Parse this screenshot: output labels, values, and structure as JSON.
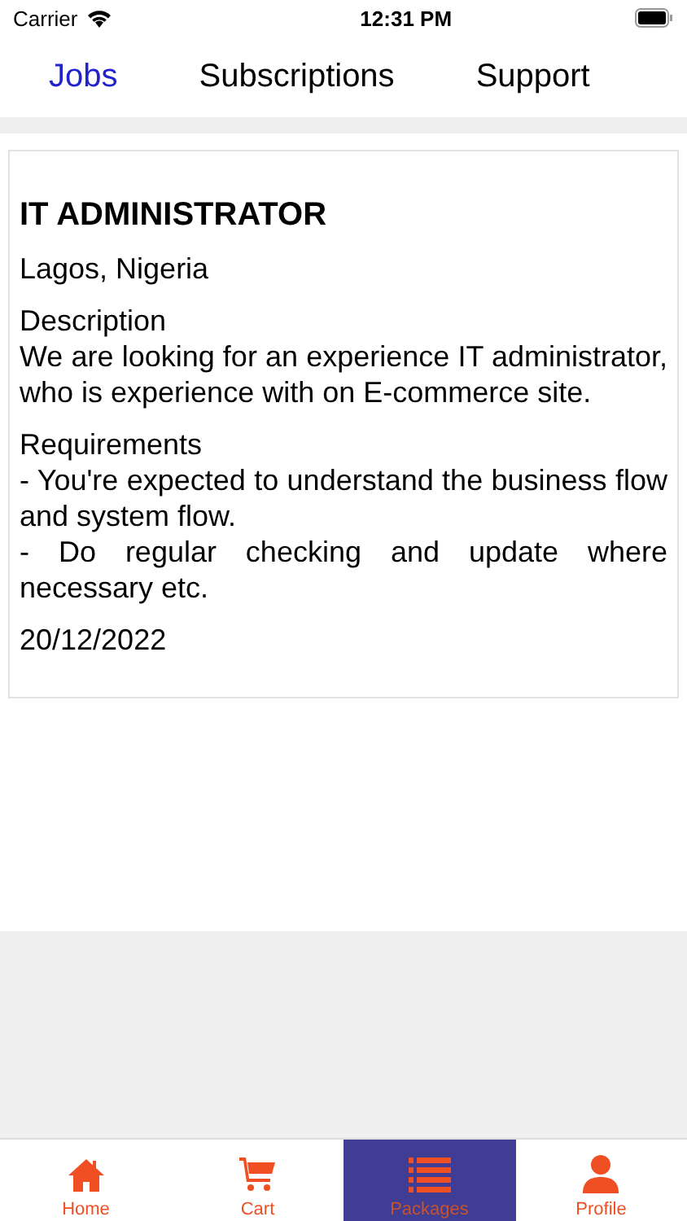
{
  "status_bar": {
    "carrier": "Carrier",
    "time": "12:31 PM"
  },
  "tabs": [
    {
      "label": "Jobs",
      "selected": true
    },
    {
      "label": "Subscriptions",
      "selected": false
    },
    {
      "label": "Support",
      "selected": false
    }
  ],
  "job": {
    "title": "IT ADMINISTRATOR",
    "location": "Lagos, Nigeria",
    "description_label": "Description",
    "description": "We are looking for an experience IT administrator, who is experience with on E-commerce site.",
    "requirements_label": "Requirements",
    "requirements": [
      "- You're expected to understand the business flow and system flow.",
      "- Do regular checking and update where necessary etc."
    ],
    "date": "20/12/2022"
  },
  "bottom_nav": [
    {
      "kind": "home",
      "label": "Home",
      "selected": false
    },
    {
      "kind": "cart",
      "label": "Cart",
      "selected": false
    },
    {
      "kind": "list",
      "label": "Packages",
      "selected": true
    },
    {
      "kind": "profile",
      "label": "Profile",
      "selected": false
    }
  ]
}
